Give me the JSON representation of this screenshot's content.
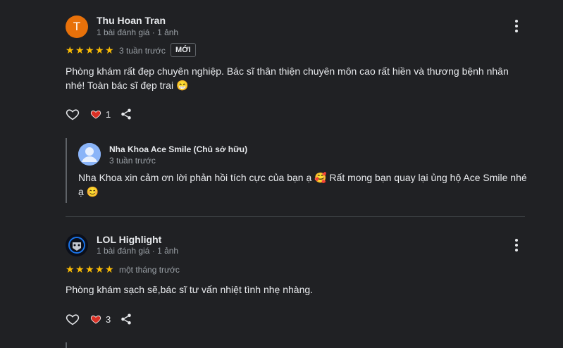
{
  "reviews": [
    {
      "author": "Thu Hoan Tran",
      "avatar_letter": "T",
      "avatar_color": "#e8710a",
      "meta": "1 bài đánh giá · 1 ảnh",
      "rating": 5,
      "time": "3 tuần trước",
      "badge": "MỚI",
      "text_line1": "Phòng khám rất đẹp chuyên nghiệp. Bác sĩ thân thiện chuyên môn cao rất hiền và thương bệnh nhân",
      "text_line2": "nhé! Toàn bác sĩ đẹp trai 😁",
      "likes": "1",
      "reply": {
        "author": "Nha Khoa Ace Smile (Chủ sở hữu)",
        "time": "3 tuần trước",
        "text_line1": "Nha Khoa xin cảm ơn lời phản hồi tích cực của bạn ạ 🥰 Rất mong bạn quay lại ủng hộ Ace Smile nhé",
        "text_line2": "ạ 😊"
      }
    },
    {
      "author": "LOL Highlight",
      "meta": "1 bài đánh giá · 1 ảnh",
      "rating": 5,
      "time": "một tháng trước",
      "text_line1": "Phòng khám sạch sẽ,bác sĩ tư vấn nhiệt tình nhẹ nhàng.",
      "likes": "3"
    }
  ],
  "colors": {
    "star": "#fbbc04",
    "heart_filled": "#d93025",
    "background": "#202124"
  },
  "icons": [
    "heart-outline-icon",
    "heart-filled-icon",
    "share-icon",
    "more-vert-icon",
    "person-icon"
  ]
}
